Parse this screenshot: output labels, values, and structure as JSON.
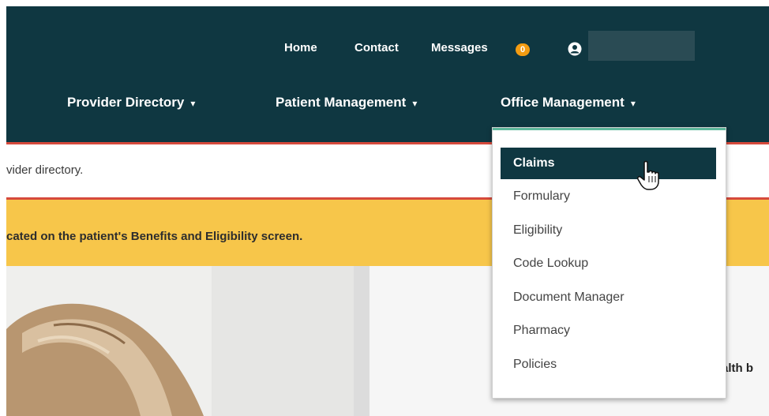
{
  "utility_nav": {
    "home": "Home",
    "contact": "Contact",
    "messages": "Messages",
    "messages_count": "0"
  },
  "main_nav": [
    {
      "label": "Provider Directory"
    },
    {
      "label": "Patient Management"
    },
    {
      "label": "Office Management"
    }
  ],
  "chevron": "▾",
  "info_text": "vider directory.",
  "alert_text": "cated on the patient's Benefits and Eligibility screen.",
  "hero": {
    "heading_fragment": "alth b"
  },
  "dropdown": {
    "items": [
      {
        "label": "Claims",
        "active": true
      },
      {
        "label": "Formulary"
      },
      {
        "label": "Eligibility"
      },
      {
        "label": "Code Lookup"
      },
      {
        "label": "Document Manager"
      },
      {
        "label": "Pharmacy"
      },
      {
        "label": "Policies"
      }
    ]
  },
  "colors": {
    "header_bg": "#0f3741",
    "banner": "#f7c64a",
    "badge": "#f39c12",
    "accent_line": "#d64a3c"
  }
}
